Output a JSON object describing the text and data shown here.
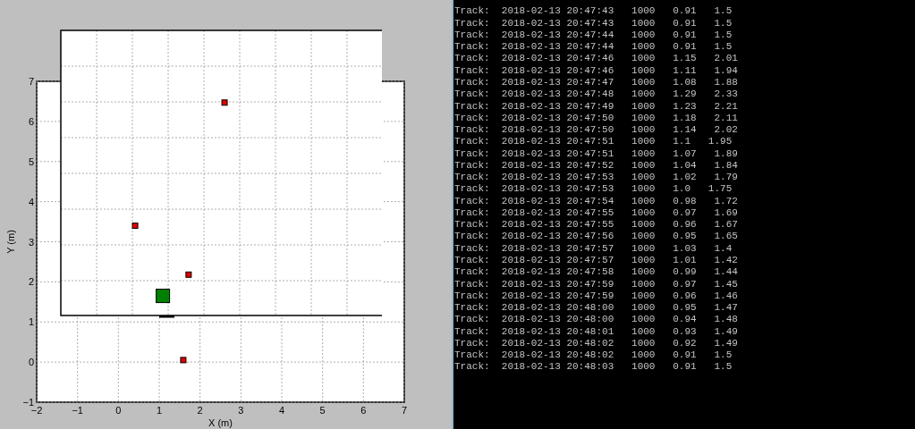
{
  "plot": {
    "chart_data": {
      "type": "scatter",
      "grid": true,
      "xlabel": "X (m)",
      "ylabel": "Y (m)",
      "xlim": [
        -2,
        7
      ],
      "ylim": [
        -1,
        7
      ],
      "xticks": [
        {
          "value": -2,
          "label": "−2"
        },
        {
          "value": -1,
          "label": "−1"
        },
        0,
        1,
        2,
        3,
        4,
        5,
        6,
        7
      ],
      "yticks": [
        {
          "value": -1,
          "label": "−1"
        },
        0,
        1,
        2,
        3,
        4,
        5,
        6,
        7
      ],
      "series": [
        {
          "color": "#e00000",
          "x": [
            2.6,
            0.41,
            1.72,
            1.59
          ],
          "values": [
            6.47,
            3.4,
            2.18,
            0.05
          ]
        },
        {
          "color": "#008000",
          "x": [
            1.09
          ],
          "values": [
            1.65
          ]
        }
      ]
    }
  },
  "terminal": {
    "lines": [
      "Track:  2018-02-13 20:47:43   1000   0.91   1.5",
      "Track:  2018-02-13 20:47:43   1000   0.91   1.5",
      "Track:  2018-02-13 20:47:44   1000   0.91   1.5",
      "Track:  2018-02-13 20:47:44   1000   0.91   1.5",
      "Track:  2018-02-13 20:47:46   1000   1.15   2.01",
      "Track:  2018-02-13 20:47:46   1000   1.11   1.94",
      "Track:  2018-02-13 20:47:47   1000   1.08   1.88",
      "Track:  2018-02-13 20:47:48   1000   1.29   2.33",
      "Track:  2018-02-13 20:47:49   1000   1.23   2.21",
      "Track:  2018-02-13 20:47:50   1000   1.18   2.11",
      "Track:  2018-02-13 20:47:50   1000   1.14   2.02",
      "Track:  2018-02-13 20:47:51   1000   1.1   1.95",
      "Track:  2018-02-13 20:47:51   1000   1.07   1.89",
      "Track:  2018-02-13 20:47:52   1000   1.04   1.84",
      "Track:  2018-02-13 20:47:53   1000   1.02   1.79",
      "Track:  2018-02-13 20:47:53   1000   1.0   1.75",
      "Track:  2018-02-13 20:47:54   1000   0.98   1.72",
      "Track:  2018-02-13 20:47:55   1000   0.97   1.69",
      "Track:  2018-02-13 20:47:55   1000   0.96   1.67",
      "Track:  2018-02-13 20:47:56   1000   0.95   1.65",
      "Track:  2018-02-13 20:47:57   1000   1.03   1.4",
      "Track:  2018-02-13 20:47:57   1000   1.01   1.42",
      "Track:  2018-02-13 20:47:58   1000   0.99   1.44",
      "Track:  2018-02-13 20:47:59   1000   0.97   1.45",
      "Track:  2018-02-13 20:47:59   1000   0.96   1.46",
      "Track:  2018-02-13 20:48:00   1000   0.95   1.47",
      "Track:  2018-02-13 20:48:00   1000   0.94   1.48",
      "Track:  2018-02-13 20:48:01   1000   0.93   1.49",
      "Track:  2018-02-13 20:48:02   1000   0.92   1.49",
      "Track:  2018-02-13 20:48:02   1000   0.91   1.5",
      "Track:  2018-02-13 20:48:03   1000   0.91   1.5"
    ]
  }
}
